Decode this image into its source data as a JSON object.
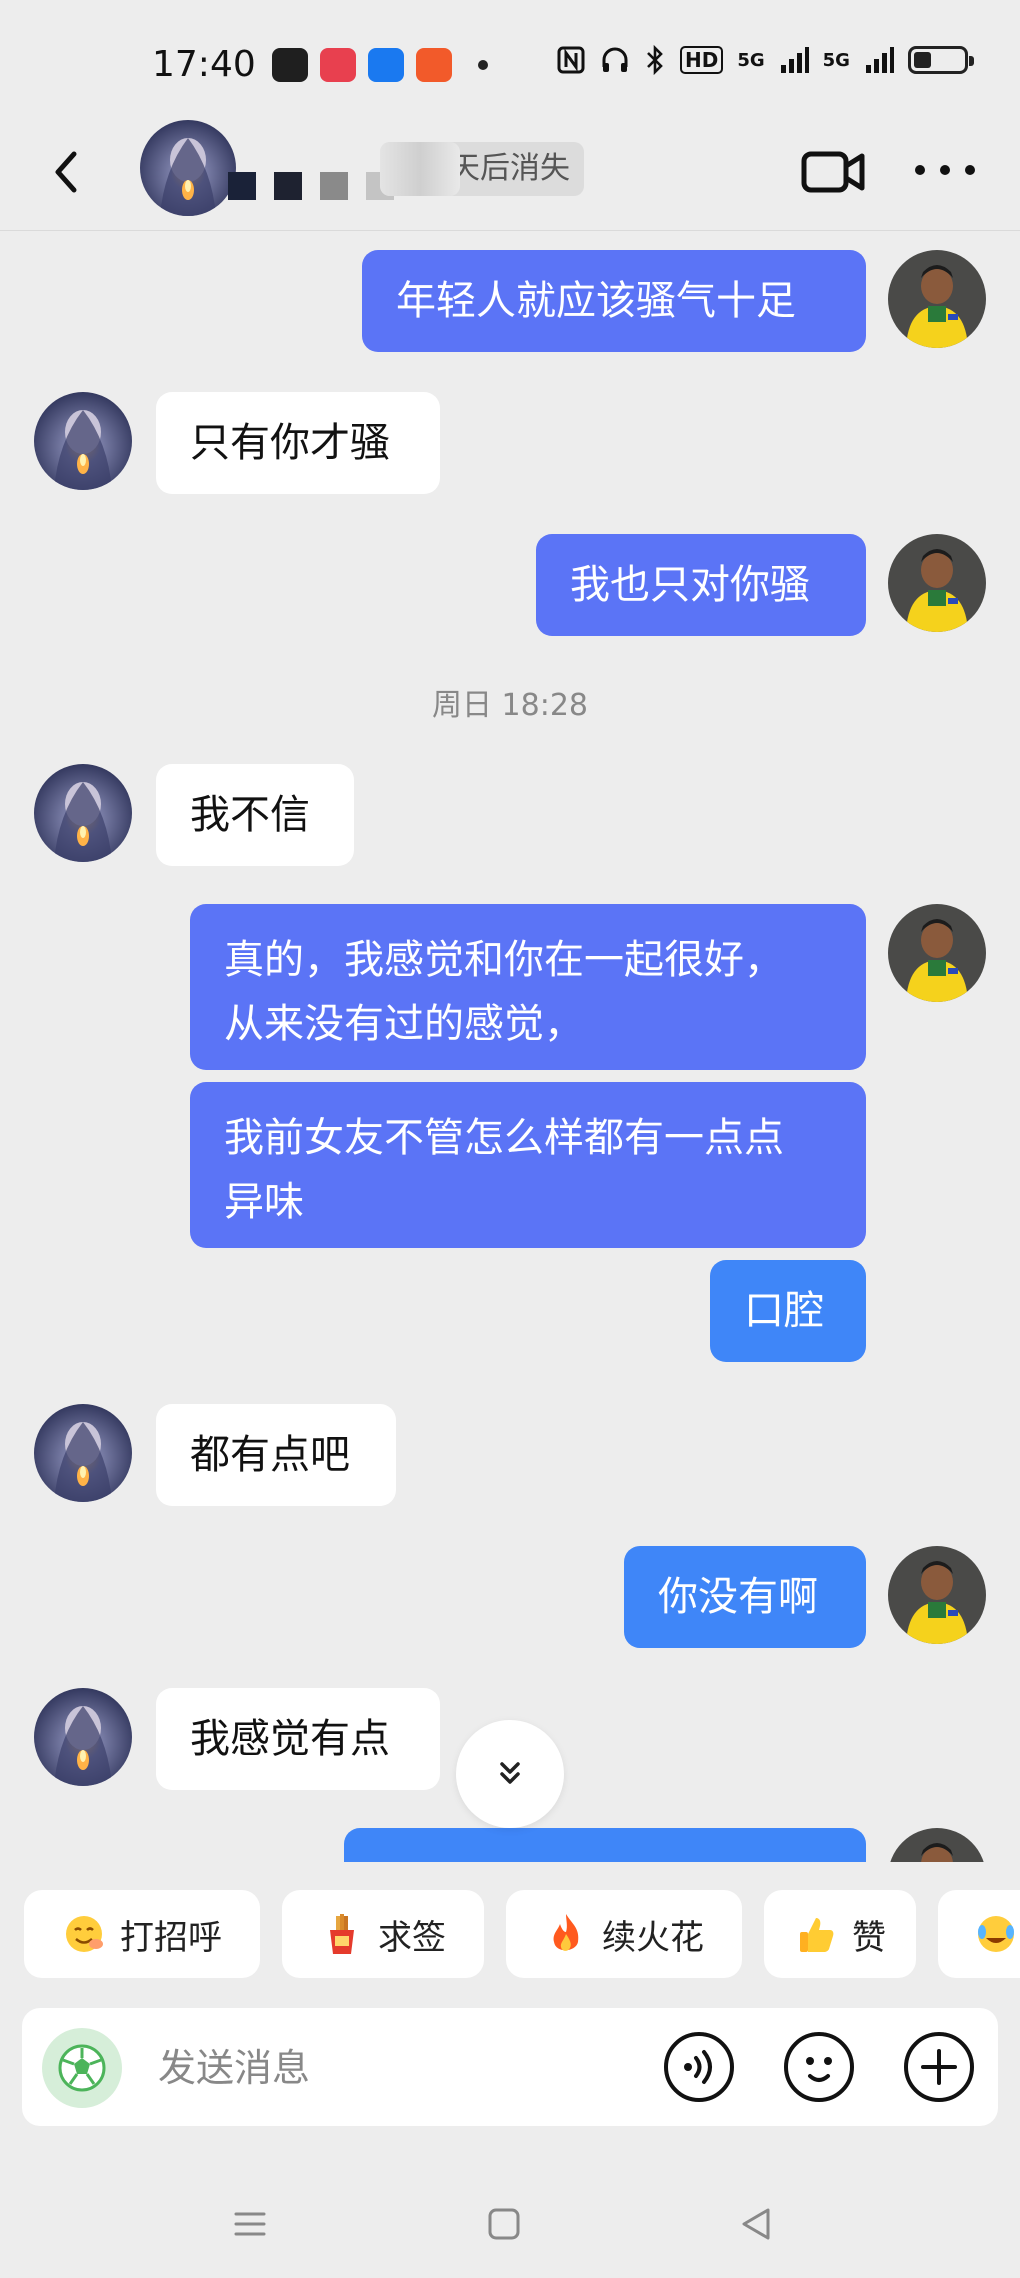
{
  "status_bar": {
    "time": "17:40",
    "network": [
      "5G",
      "5G"
    ],
    "hd_badge": "HD",
    "battery_level": 0.35
  },
  "header": {
    "disappear_text": "天后消失"
  },
  "messages": [
    {
      "dir": "out",
      "text": "年轻人就应该骚气十足"
    },
    {
      "dir": "in",
      "text": "只有你才骚"
    },
    {
      "dir": "out",
      "text": "我也只对你骚"
    },
    {
      "dir": "time",
      "text": "周日 18:28"
    },
    {
      "dir": "in",
      "text": "我不信"
    },
    {
      "dir": "out",
      "lines": [
        "真的，我感觉和你在一起很好，",
        "从来没有过的感觉，"
      ]
    },
    {
      "dir": "out",
      "lines": [
        "我前女友不管怎么样都有一点点",
        "异味"
      ]
    },
    {
      "dir": "out",
      "text": "口腔"
    },
    {
      "dir": "in",
      "text": "都有点吧"
    },
    {
      "dir": "out",
      "text": "你没有啊"
    },
    {
      "dir": "in",
      "text": "我感觉有点"
    }
  ],
  "quick_replies": [
    "打招呼",
    "求签",
    "续火花",
    "赞"
  ],
  "composer": {
    "placeholder": "发送消息"
  },
  "colors": {
    "outgoing_bubble": "#5b74f6",
    "outgoing_bubble_alt": "#3f86f8",
    "incoming_bubble": "#ffffff",
    "background": "#ededed"
  },
  "icons": {
    "back": "chevron-left-icon",
    "video": "video-camera-icon",
    "more": "more-dots-icon",
    "scroll": "double-chevron-down-icon",
    "football": "football-icon",
    "voice": "voice-icon",
    "emoji": "emoji-icon",
    "plus": "plus-icon"
  }
}
